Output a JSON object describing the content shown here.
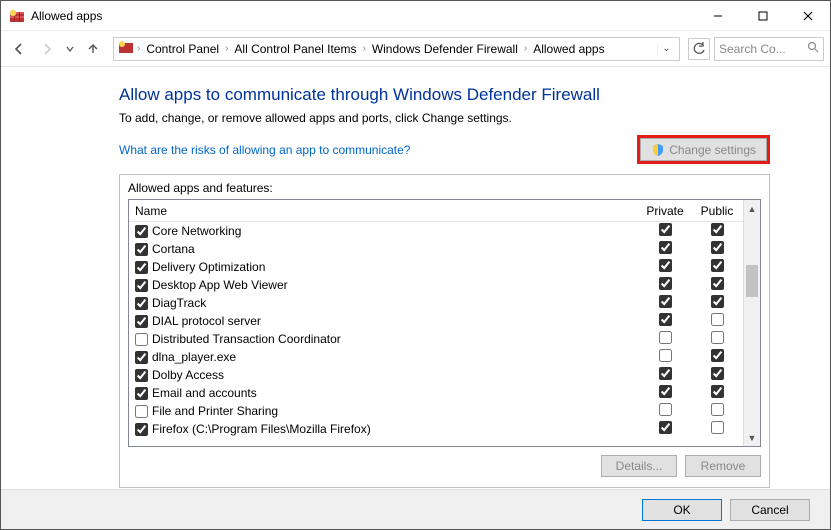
{
  "window": {
    "title": "Allowed apps"
  },
  "breadcrumb": {
    "items": [
      "Control Panel",
      "All Control Panel Items",
      "Windows Defender Firewall",
      "Allowed apps"
    ]
  },
  "search": {
    "placeholder": "Search Co..."
  },
  "main": {
    "heading": "Allow apps to communicate through Windows Defender Firewall",
    "subheading": "To add, change, or remove allowed apps and ports, click Change settings.",
    "risks_link": "What are the risks of allowing an app to communicate?",
    "change_settings_label": "Change settings",
    "panel_label": "Allowed apps and features:",
    "columns": {
      "name": "Name",
      "private": "Private",
      "public": "Public"
    },
    "details_label": "Details...",
    "remove_label": "Remove"
  },
  "apps": [
    {
      "name": "Core Networking",
      "allowed": true,
      "private": true,
      "public": true
    },
    {
      "name": "Cortana",
      "allowed": true,
      "private": true,
      "public": true
    },
    {
      "name": "Delivery Optimization",
      "allowed": true,
      "private": true,
      "public": true
    },
    {
      "name": "Desktop App Web Viewer",
      "allowed": true,
      "private": true,
      "public": true
    },
    {
      "name": "DiagTrack",
      "allowed": true,
      "private": true,
      "public": true
    },
    {
      "name": "DIAL protocol server",
      "allowed": true,
      "private": true,
      "public": false
    },
    {
      "name": "Distributed Transaction Coordinator",
      "allowed": false,
      "private": false,
      "public": false
    },
    {
      "name": "dlna_player.exe",
      "allowed": true,
      "private": false,
      "public": true
    },
    {
      "name": "Dolby Access",
      "allowed": true,
      "private": true,
      "public": true
    },
    {
      "name": "Email and accounts",
      "allowed": true,
      "private": true,
      "public": true
    },
    {
      "name": "File and Printer Sharing",
      "allowed": false,
      "private": false,
      "public": false
    },
    {
      "name": "Firefox (C:\\Program Files\\Mozilla Firefox)",
      "allowed": true,
      "private": true,
      "public": false
    }
  ],
  "footer": {
    "ok": "OK",
    "cancel": "Cancel"
  }
}
